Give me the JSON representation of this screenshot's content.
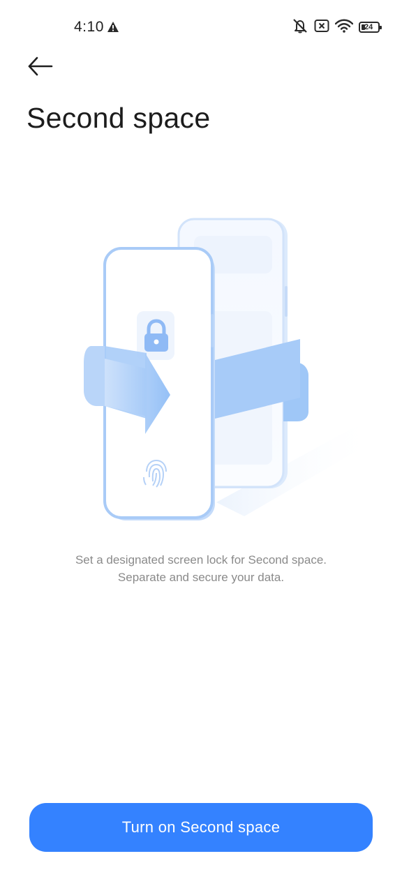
{
  "status_bar": {
    "time": "4:10",
    "battery_level": "24",
    "icons": [
      "alert-icon",
      "mute-icon",
      "sim-x-icon",
      "wifi-icon",
      "battery-icon"
    ]
  },
  "header": {
    "title": "Second space",
    "back_icon": "arrow-left-icon"
  },
  "illustration": {
    "icons": [
      "lock-icon",
      "arrow-right-icon",
      "fingerprint-icon"
    ],
    "accent_color": "#7fb3f5"
  },
  "description": {
    "line1": "Set a designated screen lock for Second space.",
    "line2": "Separate and secure your data."
  },
  "actions": {
    "primary_label": "Turn on Second space",
    "primary_color": "#3482ff"
  }
}
